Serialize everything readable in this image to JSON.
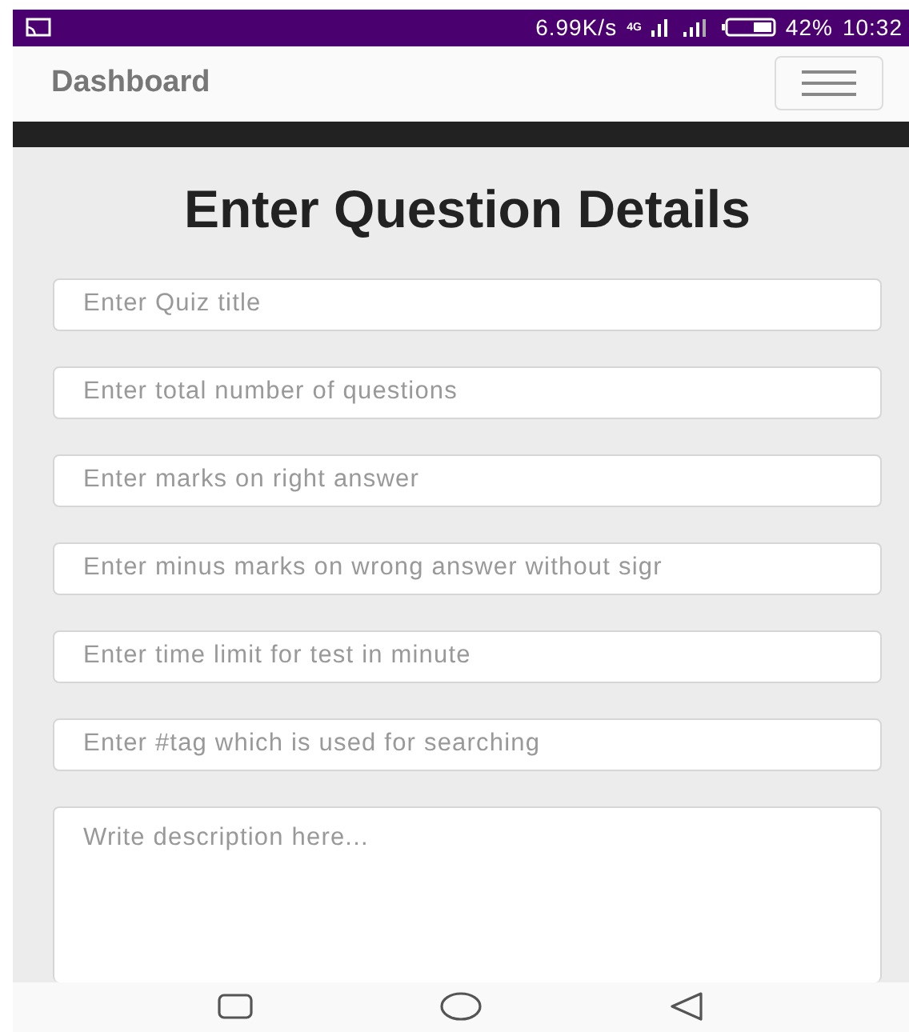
{
  "status_bar": {
    "speed": "6.99K/s",
    "network": "4G",
    "battery": "42%",
    "time": "10:32"
  },
  "navbar": {
    "brand": "Dashboard"
  },
  "form": {
    "heading": "Enter Question Details",
    "fields": [
      {
        "placeholder": "Enter Quiz title"
      },
      {
        "placeholder": "Enter total number of questions"
      },
      {
        "placeholder": "Enter marks on right answer"
      },
      {
        "placeholder": "Enter minus marks on wrong answer without sigr"
      },
      {
        "placeholder": "Enter time limit for test in minute"
      },
      {
        "placeholder": "Enter #tag which is used for searching"
      }
    ],
    "description": {
      "placeholder": "Write description here..."
    }
  }
}
